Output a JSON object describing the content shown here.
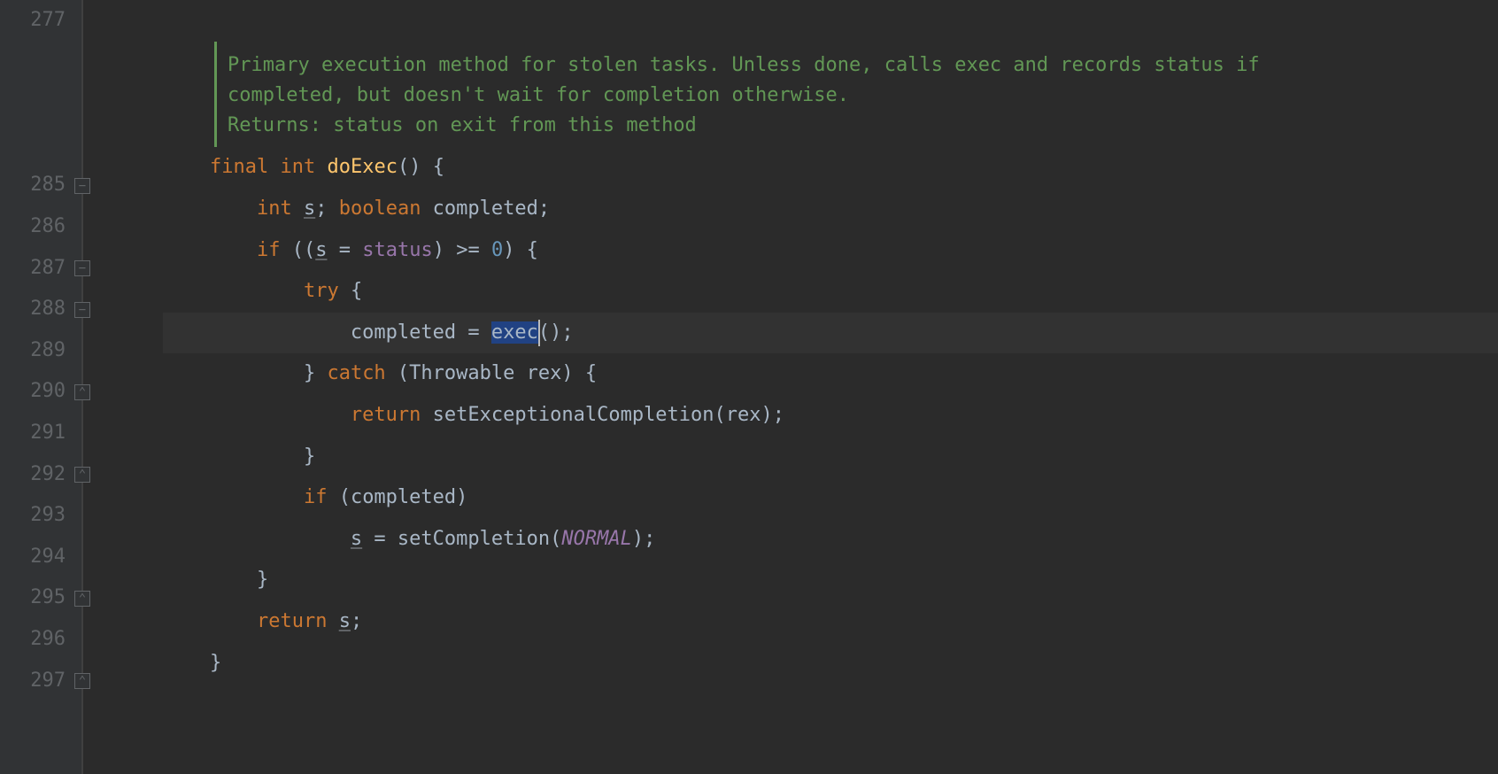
{
  "gutter": {
    "lines": [
      "277",
      "",
      "",
      "",
      "285",
      "286",
      "287",
      "288",
      "289",
      "290",
      "291",
      "292",
      "293",
      "294",
      "295",
      "296",
      "297"
    ]
  },
  "doc": {
    "line1": "Primary execution method for stolen tasks. Unless done, calls exec and records status if",
    "line2": "completed, but doesn't wait for completion otherwise.",
    "line3": "Returns: status on exit from this method"
  },
  "code": {
    "l285": {
      "kw_final": "final",
      "kw_int": "int",
      "method": "doExec",
      "rest": "() {"
    },
    "l286": {
      "indent": "        ",
      "kw_int": "int",
      "s": "s",
      "sep": "; ",
      "kw_bool": "boolean",
      "var_completed": " completed;"
    },
    "l287": {
      "indent": "        ",
      "kw_if": "if",
      "open": " ((",
      "s": "s",
      "eq": " = ",
      "field": "status",
      "cmp": ") >= ",
      "num": "0",
      "close": ") {"
    },
    "l288": {
      "indent": "            ",
      "kw_try": "try",
      "brace": " {"
    },
    "l289": {
      "indent": "                ",
      "lhs": "completed = ",
      "sel": "exec",
      "tail": "();"
    },
    "l290": {
      "indent": "            ",
      "close": "} ",
      "kw_catch": "catch",
      "args": " (Throwable rex) {"
    },
    "l291": {
      "indent": "                ",
      "kw_return": "return",
      "call": " setExceptionalCompletion(rex);"
    },
    "l292": {
      "indent": "            ",
      "brace": "}"
    },
    "l293": {
      "indent": "            ",
      "kw_if": "if",
      "cond": " (completed)"
    },
    "l294": {
      "indent": "                ",
      "s": "s",
      "eq": " = setCompletion(",
      "const": "NORMAL",
      "close": ");"
    },
    "l295": {
      "indent": "        ",
      "brace": "}"
    },
    "l296": {
      "indent": "        ",
      "kw_return": "return",
      "sp": " ",
      "s": "s",
      "semi": ";"
    },
    "l297": {
      "indent": "    ",
      "brace": "}"
    }
  },
  "fold_markers": [
    {
      "line_index": 4,
      "glyph": "−"
    },
    {
      "line_index": 6,
      "glyph": "−"
    },
    {
      "line_index": 7,
      "glyph": "−"
    },
    {
      "line_index": 9,
      "glyph": "⌃"
    },
    {
      "line_index": 11,
      "glyph": "⌃"
    },
    {
      "line_index": 14,
      "glyph": "⌃"
    },
    {
      "line_index": 16,
      "glyph": "⌃"
    }
  ]
}
